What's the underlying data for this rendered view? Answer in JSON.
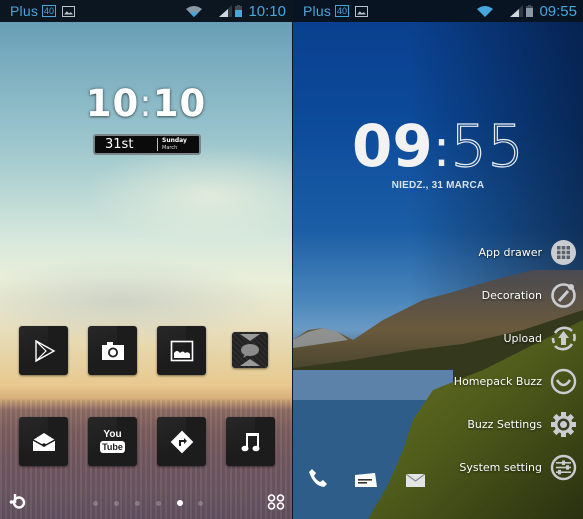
{
  "screens": {
    "left": {
      "statusbar": {
        "carrier": "Plus",
        "network_badge": "40",
        "time": "10:10",
        "icons": [
          "image-notification-icon",
          "wifi-icon",
          "signal-icon",
          "battery-icon"
        ]
      },
      "clock": {
        "hours": "10",
        "separator": ":",
        "minutes": "10"
      },
      "date_widget": {
        "day": "31st",
        "weekday": "Sunday",
        "month": "March"
      },
      "app_rows": [
        [
          {
            "name": "play-store",
            "icon": "play-store-icon"
          },
          {
            "name": "camera",
            "icon": "camera-icon"
          },
          {
            "name": "gallery",
            "icon": "gallery-icon"
          },
          {
            "name": "chat-widget",
            "icon": "chat-bubble-icon"
          }
        ],
        [
          {
            "name": "email",
            "icon": "envelope-icon"
          },
          {
            "name": "youtube",
            "icon": "youtube-icon",
            "text_top": "You",
            "text_bottom": "Tube"
          },
          {
            "name": "navigation",
            "icon": "directions-icon"
          },
          {
            "name": "music",
            "icon": "music-note-icon"
          }
        ]
      ],
      "dock": {
        "left_icon": "buzz-launcher-icon",
        "right_icon": "app-drawer-icon",
        "page_count": 6,
        "active_page": 4
      }
    },
    "right": {
      "statusbar": {
        "carrier": "Plus",
        "network_badge": "40",
        "time": "09:55",
        "icons": [
          "image-notification-icon",
          "wifi-icon",
          "signal-icon",
          "battery-icon"
        ]
      },
      "clock": {
        "hours": "09",
        "separator": ":",
        "minutes": "55"
      },
      "date": "NIEDZ., 31 MARCA",
      "menu": [
        {
          "label": "App drawer",
          "icon": "grid-icon"
        },
        {
          "label": "Decoration",
          "icon": "brush-icon"
        },
        {
          "label": "Upload",
          "icon": "upload-icon"
        },
        {
          "label": "Homepack Buzz",
          "icon": "smile-icon"
        },
        {
          "label": "Buzz Settings",
          "icon": "gear-icon"
        },
        {
          "label": "System setting",
          "icon": "sliders-icon"
        }
      ],
      "bottom_bar": [
        "phone-icon",
        "message-icon",
        "mail-icon"
      ]
    }
  },
  "colors": {
    "statusbar_bg": "#0c1620",
    "statusbar_text": "#46a7de",
    "tile_bg": "#1c1c1c"
  }
}
